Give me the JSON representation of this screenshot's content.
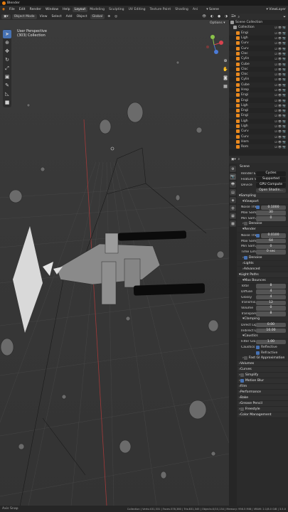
{
  "title": "Blender",
  "menu": [
    "File",
    "Edit",
    "Render",
    "Window",
    "Help"
  ],
  "workspaces": [
    "Layout",
    "Modeling",
    "Sculpting",
    "UV Editing",
    "Texture Paint",
    "Shading",
    "Ani"
  ],
  "active_workspace": "Layout",
  "scene_label": "Scene",
  "viewlayer_label": "ViewLayer",
  "viewport_header": {
    "mode": "Object Mode",
    "menus": [
      "View",
      "Select",
      "Add",
      "Object"
    ],
    "transform": "Global",
    "options": "Options"
  },
  "viewport_overlay": {
    "line1": "User Perspective",
    "line2": "(303) Collection"
  },
  "outliner": {
    "collection": "Scene Collection",
    "sub": "Collection",
    "items": [
      "Engi",
      "Ligh",
      "Curv",
      "Curv",
      "Cloc",
      "Cylin",
      "Cube",
      "Cloc",
      "Cloc",
      "Cylin",
      "Cube",
      "Hrep",
      "Engi",
      "Engi",
      "Ligh",
      "Engi",
      "Engi",
      "Ligh",
      "Ligh",
      "Curv",
      "Curv",
      "Hem",
      "Rom"
    ]
  },
  "properties": {
    "header": "Scene",
    "render_engine_label": "Render En...",
    "render_engine": "Cycles",
    "feature_set_label": "Feature Set",
    "feature_set": "Supported",
    "device_label": "Device",
    "device": "GPU Compute",
    "open_shading": "Open Shadin...",
    "sampling": "Sampling",
    "viewport": "Viewport",
    "vp_noise_label": "Noise Thr...",
    "vp_noise": "0.1000",
    "vp_max_label": "Max Sam...",
    "vp_max": "30",
    "vp_min_label": "Min Sam...",
    "vp_min": "0",
    "denoise": "Denoise",
    "render": "Render",
    "r_noise_label": "Noise Thr...",
    "r_noise": "0.0100",
    "r_max_label": "Max Sam...",
    "r_max": "64",
    "r_min_label": "Min Sam...",
    "r_min": "0",
    "time_limit_label": "Time Limit",
    "time_limit": "0 sec",
    "r_denoise": "Denoise",
    "lights": "Lights",
    "advanced": "Advanced",
    "light_paths": "Light Paths",
    "max_bounces": "Max Bounces",
    "total_label": "Total",
    "total": "8",
    "diffuse_label": "Diffuse",
    "diffuse": "4",
    "glossy_label": "Glossy",
    "glossy": "4",
    "transmission_label": "Transmis...",
    "transmission": "12",
    "volume_label": "Volume",
    "volume": "0",
    "transparent_label": "Transparent",
    "transparent": "8",
    "clamping": "Clamping",
    "direct_label": "Direct Light",
    "direct": "0.00",
    "indirect_label": "Indirect L...",
    "indirect": "10.00",
    "caustics": "Caustics",
    "filter_label": "Filter Glo...",
    "filter": "1.00",
    "caustics_label": "Caustics",
    "reflective": "Reflective",
    "refractive": "Refractive",
    "fast_gi": "Fast GI Approximation",
    "volumes": "Volumes",
    "curves": "Curves",
    "simplify": "Simplify",
    "motion_blur": "Motion Blur",
    "film": "Film",
    "performance": "Performance",
    "bake": "Bake",
    "grease_pencil": "Grease Pencil",
    "freestyle": "Freestyle",
    "color_mgmt": "Color Management"
  },
  "status": {
    "left": "Axis Snap",
    "right": "Collection | Verts:431,331 | Faces:378,380 | Tris:831,345 | Objects:0/10,134 | Memory: 956.5 MiB | VRAM: 2.1/8.0 GiB | 3.5.0"
  }
}
